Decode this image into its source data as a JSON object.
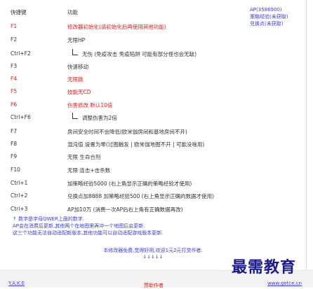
{
  "header": {
    "col_key": "快捷键",
    "col_func": "功能"
  },
  "status": {
    "ap": "AP(3586900)",
    "strategy": "策略经验(未获取)",
    "exchange": "兑换点(未获取)"
  },
  "rows": [
    {
      "key": "F1",
      "func": "修改器初始化(请初始化后再使用其他功能)",
      "red": true
    },
    {
      "key": "F2",
      "func": "无限HP"
    },
    {
      "key": "Ctrl+F2",
      "func": "无伤 (免疫攻击 免疫陷阱 可能有部分怪也会无敌)",
      "sub": true
    },
    {
      "key": "F3",
      "func": "快速移动"
    },
    {
      "key": "F4",
      "func": "无限跳",
      "red": true
    },
    {
      "key": "F5",
      "func": "技能无CD",
      "red": true
    },
    {
      "key": "F6",
      "func": "伤害修改 默认10倍",
      "red": true
    },
    {
      "key": "Ctrl+F6",
      "func": "调整伤害为2倍",
      "sub": true
    },
    {
      "key": "F7",
      "func": "房间安全时间不会降低(欧米伽房间和基地房间不开)"
    },
    {
      "key": "F8",
      "func": "混沌值 设置为零(过图触发 | 欧米伽地图不开 | 可能没啥用)"
    },
    {
      "key": "F9",
      "func": "无限 生命合剂"
    },
    {
      "key": "F10",
      "func": "无限 连击+击杀数"
    },
    {
      "key": "Ctrl+1",
      "func": "加策略经验5000 (右上角显示正确的策略经验才使用)"
    },
    {
      "key": "Ctrl+2",
      "func": "兑换点加8888 加策略经验500 (右上角显示正确的数据才使用)"
    },
    {
      "key": "Ctrl+3",
      "func": "AP加10万 (消费一次AP后右上角有正确数据再改)"
    }
  ],
  "notes": [
    "↑ 数字是字母QWER上面的数字.",
    "AP会在消费后更新,其他两个在地图里再冲一个地图后会更新.",
    "这三个功能无法自动适配新版本,其他功能可以自动适配游戏版本更新."
  ],
  "footer_msg": "本修改器免费,觉得好用,欢迎1元2元打赏作者.",
  "footer_arrows": "↓↓↓↓↓",
  "bottom": {
    "left": "Y.A.K.E",
    "right": "www.getce.cn",
    "middle": "赞助作者"
  },
  "watermark": "最需教育"
}
